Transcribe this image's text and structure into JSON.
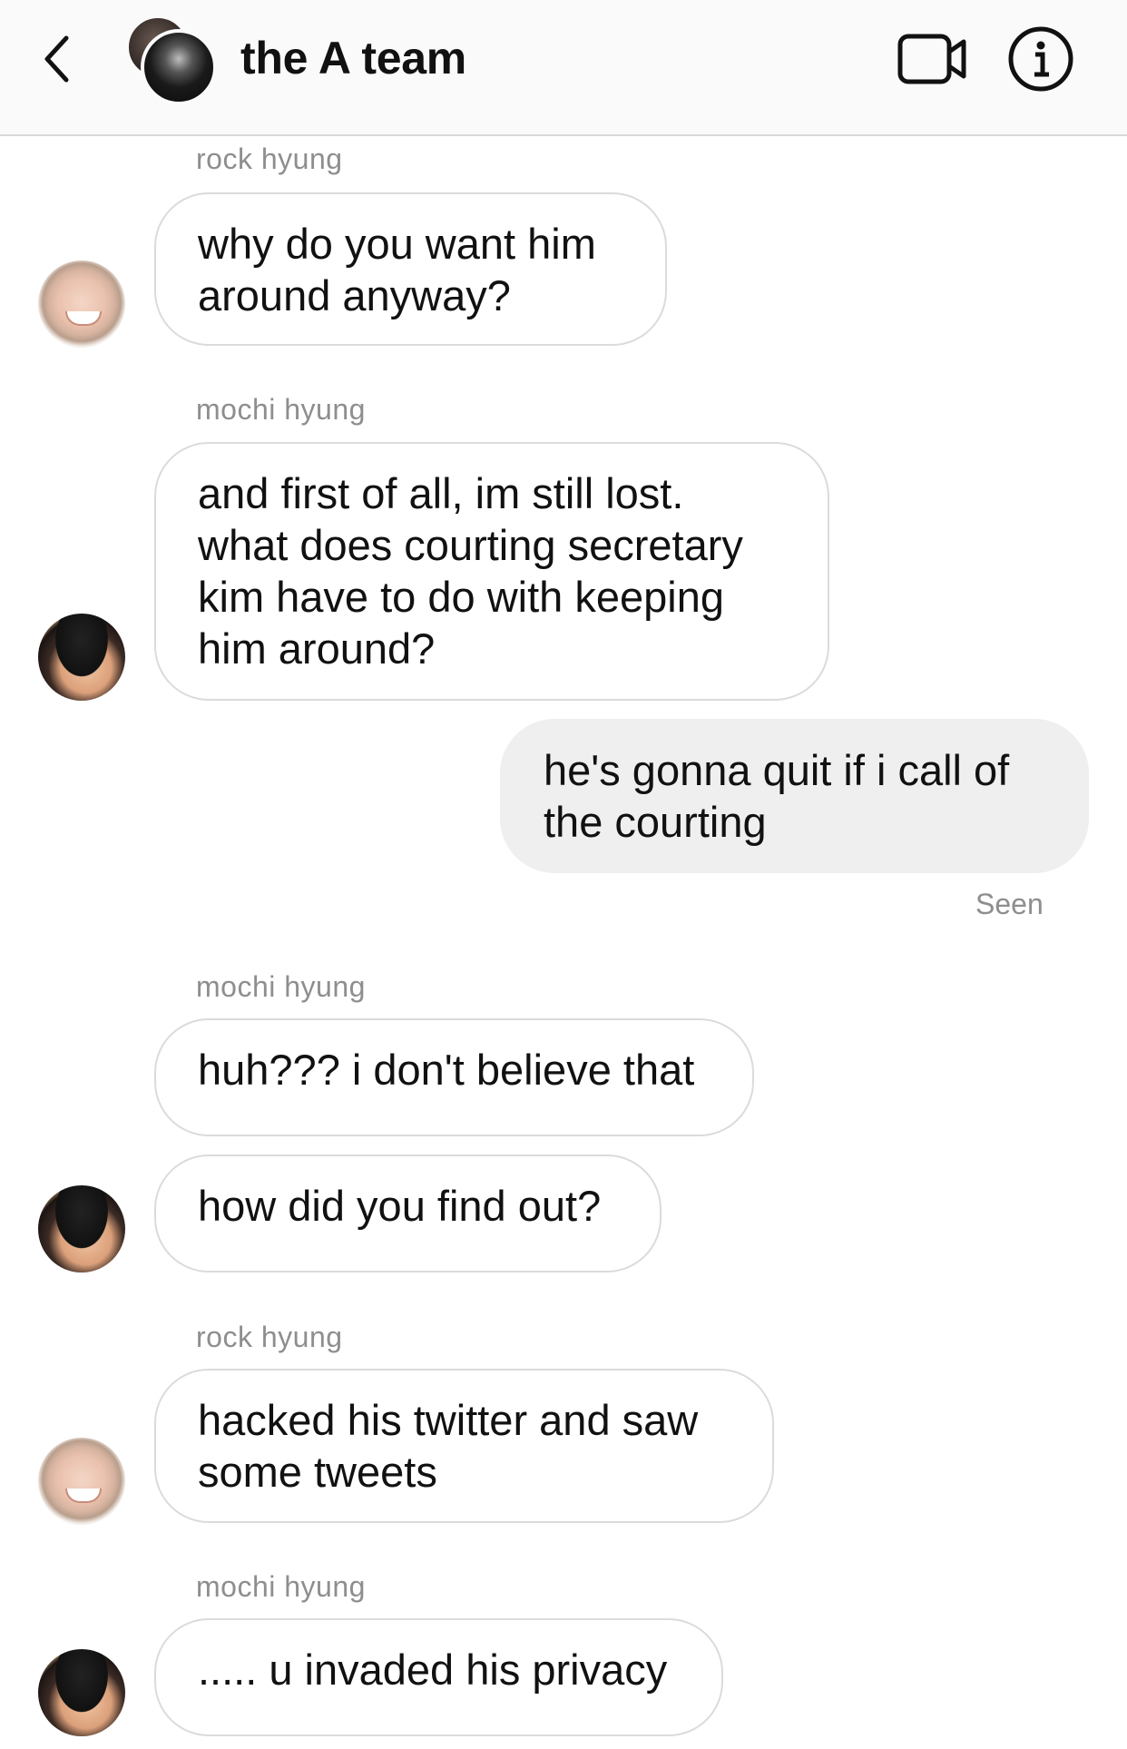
{
  "header": {
    "title": "the A team",
    "back_icon": "chevron-left-icon",
    "video_icon": "video-camera-icon",
    "info_icon": "info-icon"
  },
  "messages": [
    {
      "sender": "rock hyung",
      "direction": "incoming",
      "lines": [
        "why do you want him",
        "around anyway?"
      ]
    },
    {
      "sender": "mochi hyung",
      "direction": "incoming",
      "lines": [
        "and first of all, im still lost.",
        "what does courting secretary",
        "kim have to do with keeping",
        "him around?"
      ]
    },
    {
      "sender": "",
      "direction": "outgoing",
      "lines": [
        "he's gonna quit if i call of",
        "the courting"
      ]
    },
    {
      "sender": "mochi hyung",
      "direction": "incoming",
      "lines": [
        "huh??? i don't believe that"
      ]
    },
    {
      "sender": "",
      "direction": "incoming",
      "lines": [
        "how did you find out?"
      ]
    },
    {
      "sender": "rock hyung",
      "direction": "incoming",
      "lines": [
        "hacked his twitter and saw",
        "some tweets"
      ]
    },
    {
      "sender": "mochi hyung",
      "direction": "incoming",
      "lines": [
        "..... u invaded his privacy"
      ]
    }
  ],
  "status": {
    "seen_label": "Seen"
  },
  "colors": {
    "outgoing_bubble": "#efefef",
    "incoming_border": "#dbdbdb",
    "meta_text": "#8e8e8e"
  }
}
